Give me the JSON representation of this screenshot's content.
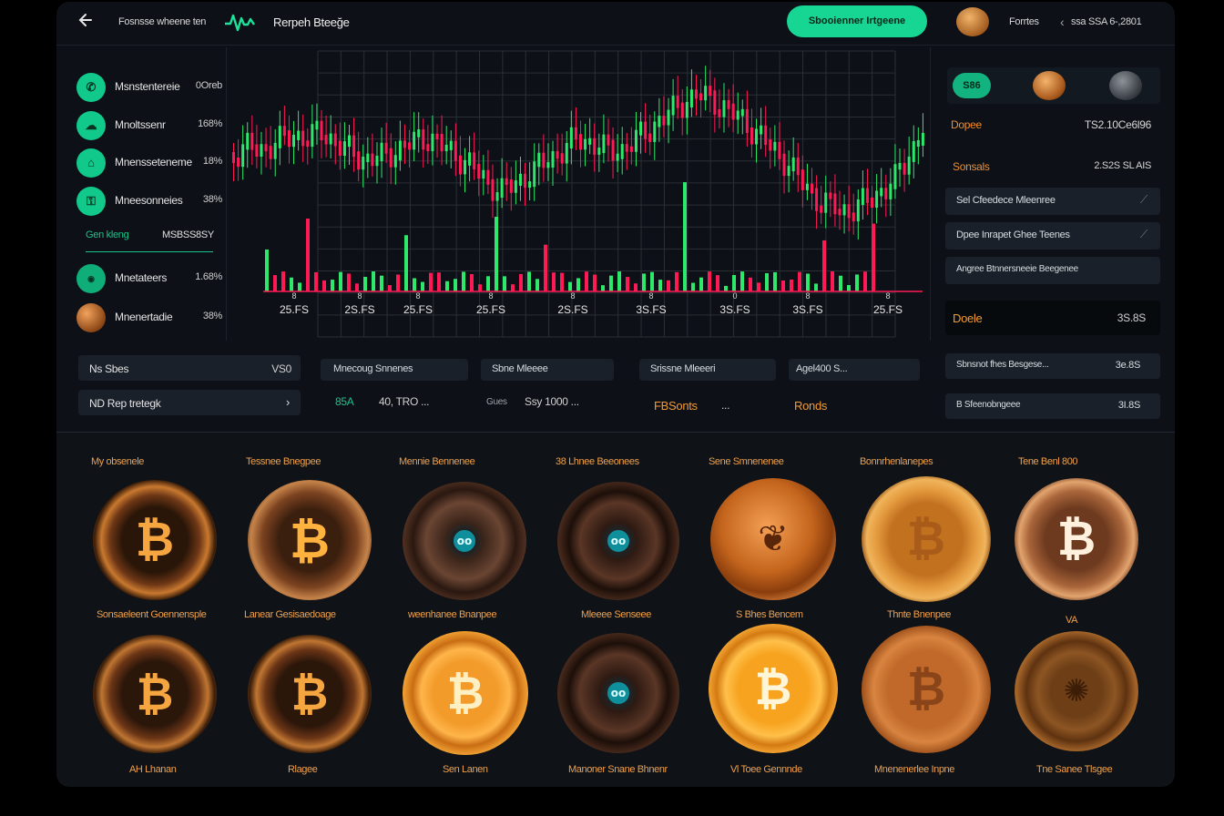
{
  "header": {
    "back_icon": "arrow-left-icon",
    "nav_label": "Fosnsse wheene ten",
    "brand": "Rerpeh Bteeğe",
    "cta_label": "Sbooienner Irtgeene",
    "user_label": "Forrtes",
    "balance": "ssa SSA 6-,2801"
  },
  "watchlist": [
    {
      "name": "Msnstentereie",
      "value": "0Oreb"
    },
    {
      "name": "Mnoltssenr",
      "value": "168%"
    },
    {
      "name": "Mnensseteneme",
      "value": "18%"
    },
    {
      "name": "Mneesonneies",
      "value": "38%"
    }
  ],
  "watchlist_section": {
    "label": "Gen kleng",
    "value": "MSBSS8SY"
  },
  "watchlist2": [
    {
      "name": "Mnetateers",
      "value": "1.68%"
    },
    {
      "name": "Mnenertadie",
      "value": "38%"
    }
  ],
  "chart_data": {
    "type": "candlestick",
    "x_labels": [
      "25.FS",
      "2S.FS",
      "25.FS",
      "25.FS",
      "2S.FS",
      "3S.FS",
      "3S.FS",
      "3S.FS",
      "25.FS"
    ],
    "x_ticks": [
      "8",
      "8",
      "8",
      "8",
      "8",
      "8",
      "0",
      "8",
      "8"
    ],
    "colors": {
      "up": "#2ee86b",
      "down": "#ff1a55",
      "grid": "#2a2f36"
    }
  },
  "left_panels": [
    {
      "label": "Ns Sbes",
      "value": "VS0"
    },
    {
      "label": "ND  Rep tretegk",
      "icon": "chevron-right-icon"
    }
  ],
  "chips": [
    "Mnecoug Snnenes",
    "Sbne Mleeee",
    "Srissne Mleeeri",
    "Agel400   S..."
  ],
  "stats": [
    {
      "label": "85A",
      "value": "40, TRO  ...",
      "color": "#19c58a"
    },
    {
      "label": "Gues",
      "value": "Ssy 1000  ...",
      "color": "#c8c8c8"
    },
    {
      "label": "FBSonts",
      "value": "...",
      "color": "#f39a34"
    },
    {
      "label": "Ronds",
      "value": "",
      "color": "#f39a34"
    }
  ],
  "right": {
    "pill_label": "S86",
    "rows": [
      {
        "label": "Dopee",
        "value": "TS2.10Ce6l96",
        "color": "#f08d2e"
      },
      {
        "label": "Sonsals",
        "value": "2.S2S SL AIS",
        "color": "#f08d2e"
      }
    ],
    "items": [
      {
        "label": "Sel Cfeedece Mleenree",
        "icon": "pin-icon"
      },
      {
        "label": "Dpee Inrapet Ghee Teenes",
        "icon": "pin-icon"
      },
      {
        "label": "Angree Btnnersneeie Beegenee",
        "icon": ""
      }
    ],
    "highlight": {
      "label": "Doele",
      "value": "3S.8S"
    },
    "footer": [
      {
        "label": "Sbnsnot fhes Besgese...",
        "value": "3e.8S"
      },
      {
        "label": "B Sfeenobngeee",
        "value": "3I.8S"
      }
    ]
  },
  "coins_row1": [
    {
      "label": "My obsenele",
      "caption": "Sonsaeleent Goennensple",
      "icon": "bitcoin-icon"
    },
    {
      "label": "Tessnee Bnegpee",
      "caption": "Lanear  Gesisaedoage",
      "icon": "bitcoin-icon"
    },
    {
      "label": "Mennie Bennenee",
      "caption": "weenhanee Bnanpee",
      "icon": "eye-token-icon"
    },
    {
      "label": "38 Lhnee Beeonees",
      "caption": "Mleeee Senseee",
      "icon": "eye-token-icon"
    },
    {
      "label": "Sene Smnenenee",
      "caption": "S Bhes Bencem",
      "icon": "eagle-coin-icon"
    },
    {
      "label": "Bonnrhenlanepes",
      "caption": "Thnte Bnenpee",
      "icon": "bitcoin-icon"
    },
    {
      "label": "Tene Benl 800",
      "caption": "VA",
      "icon": "bitcoin-icon"
    }
  ],
  "coins_row2": [
    {
      "caption": "AH Lhanan",
      "icon": "bitcoin-icon"
    },
    {
      "caption": "Rlagee",
      "icon": "bitcoin-icon"
    },
    {
      "caption": "Sen Lanen",
      "icon": "bitcoin-icon"
    },
    {
      "caption": "Manoner Snane Bhnenr",
      "icon": "eye-token-icon"
    },
    {
      "caption": "Vl Toee Gennnde",
      "icon": "bitcoin-icon"
    },
    {
      "caption": "Mnenenerlee Inpne",
      "icon": "bitcoin-icon"
    },
    {
      "caption": "Tne Sanee Tlsgee",
      "icon": "ornate-coin-icon"
    }
  ]
}
